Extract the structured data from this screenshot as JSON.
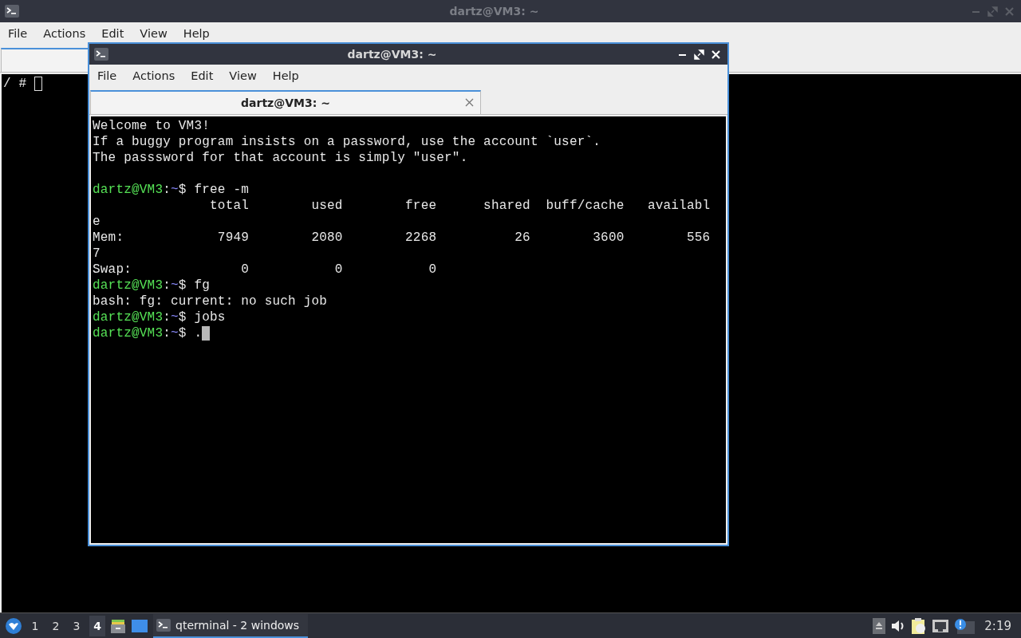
{
  "back_window": {
    "title": "dartz@VM3: ~",
    "focused": false,
    "menu": [
      "File",
      "Actions",
      "Edit",
      "View",
      "Help"
    ],
    "tabs": [
      {
        "selected": true
      }
    ],
    "terminal": {
      "cursor_focused": false,
      "lines": [
        {
          "segments": [
            {
              "kind": "text",
              "text": "/ # "
            }
          ]
        }
      ]
    }
  },
  "front_window": {
    "title": "dartz@VM3: ~",
    "focused": true,
    "menu": [
      "File",
      "Actions",
      "Edit",
      "View",
      "Help"
    ],
    "tabs": [
      {
        "label": "dartz@VM3: ~",
        "selected": true
      }
    ],
    "terminal": {
      "cursor_focused": true,
      "lines": [
        {
          "segments": [
            {
              "kind": "text",
              "text": "Welcome to VM3!"
            }
          ]
        },
        {
          "segments": [
            {
              "kind": "text",
              "text": "If a buggy program insists on a password, use the account `user`."
            }
          ]
        },
        {
          "segments": [
            {
              "kind": "text",
              "text": "The passsword for that account is simply \"user\"."
            }
          ]
        },
        {
          "kind": "blank"
        },
        {
          "segments": [
            {
              "kind": "user",
              "text": "dartz@VM3"
            },
            {
              "kind": "text",
              "text": ":"
            },
            {
              "kind": "path",
              "text": "~"
            },
            {
              "kind": "text",
              "text": "$ free -m"
            }
          ]
        },
        {
          "segments": [
            {
              "kind": "text",
              "text": "               total        used        free      shared  buff/cache   availabl"
            }
          ]
        },
        {
          "segments": [
            {
              "kind": "text",
              "text": "e"
            }
          ]
        },
        {
          "segments": [
            {
              "kind": "text",
              "text": "Mem:            7949        2080        2268          26        3600        556"
            }
          ]
        },
        {
          "segments": [
            {
              "kind": "text",
              "text": "7"
            }
          ]
        },
        {
          "segments": [
            {
              "kind": "text",
              "text": "Swap:              0           0           0"
            }
          ]
        },
        {
          "segments": [
            {
              "kind": "user",
              "text": "dartz@VM3"
            },
            {
              "kind": "text",
              "text": ":"
            },
            {
              "kind": "path",
              "text": "~"
            },
            {
              "kind": "text",
              "text": "$ fg"
            }
          ]
        },
        {
          "segments": [
            {
              "kind": "text",
              "text": "bash: fg: current: no such job"
            }
          ]
        },
        {
          "segments": [
            {
              "kind": "user",
              "text": "dartz@VM3"
            },
            {
              "kind": "text",
              "text": ":"
            },
            {
              "kind": "path",
              "text": "~"
            },
            {
              "kind": "text",
              "text": "$ jobs"
            }
          ]
        },
        {
          "segments": [
            {
              "kind": "user",
              "text": "dartz@VM3"
            },
            {
              "kind": "text",
              "text": ":"
            },
            {
              "kind": "path",
              "text": "~"
            },
            {
              "kind": "text",
              "text": "$ ."
            }
          ]
        }
      ]
    }
  },
  "taskbar": {
    "workspaces": [
      {
        "label": "1",
        "selected": false
      },
      {
        "label": "2",
        "selected": false
      },
      {
        "label": "3",
        "selected": false
      },
      {
        "label": "4",
        "selected": true
      }
    ],
    "task": {
      "label": "qterminal - 2 windows"
    },
    "clock": "2:19"
  }
}
